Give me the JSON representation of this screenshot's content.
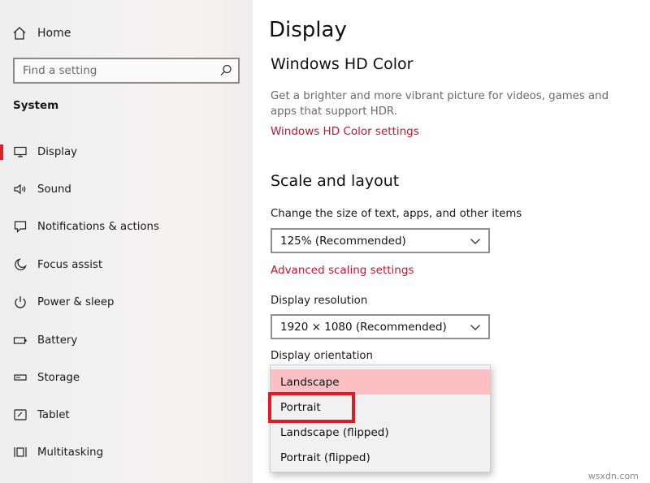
{
  "sidebar": {
    "home_label": "Home",
    "search_placeholder": "Find a setting",
    "section_title": "System",
    "items": [
      {
        "label": "Display",
        "icon": "monitor-icon",
        "active": true
      },
      {
        "label": "Sound",
        "icon": "speaker-icon"
      },
      {
        "label": "Notifications & actions",
        "icon": "notification-icon"
      },
      {
        "label": "Focus assist",
        "icon": "moon-icon"
      },
      {
        "label": "Power & sleep",
        "icon": "power-icon"
      },
      {
        "label": "Battery",
        "icon": "battery-icon"
      },
      {
        "label": "Storage",
        "icon": "storage-icon"
      },
      {
        "label": "Tablet",
        "icon": "tablet-icon"
      },
      {
        "label": "Multitasking",
        "icon": "multitasking-icon"
      }
    ]
  },
  "main": {
    "title": "Display",
    "hdr": {
      "heading": "Windows HD Color",
      "description": "Get a brighter and more vibrant picture for videos, games and apps that support HDR.",
      "link": "Windows HD Color settings"
    },
    "scale": {
      "heading": "Scale and layout",
      "size_label": "Change the size of text, apps, and other items",
      "size_value": "125% (Recommended)",
      "advanced_link": "Advanced scaling settings",
      "resolution_label": "Display resolution",
      "resolution_value": "1920 × 1080 (Recommended)",
      "orientation_label": "Display orientation",
      "orientation_options": [
        "Landscape",
        "Portrait",
        "Landscape (flipped)",
        "Portrait (flipped)"
      ],
      "orientation_selected": "Landscape"
    }
  },
  "watermark": "wsxdn.com",
  "colors": {
    "accent": "#d9202e",
    "link": "#c4162e",
    "selected_option": "#fcc0c4",
    "highlight_box": "#e01b24"
  }
}
